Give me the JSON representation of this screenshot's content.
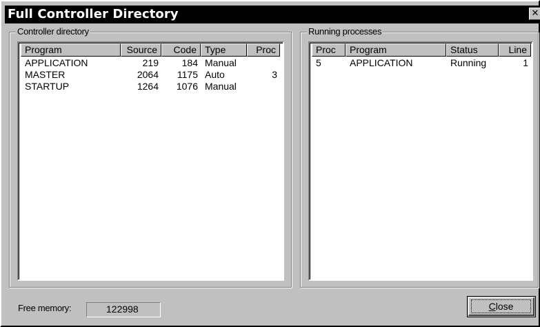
{
  "window": {
    "title": "Full Controller Directory",
    "close_glyph": "✕"
  },
  "controller_directory": {
    "label": "Controller directory",
    "columns": [
      "Program",
      "Source",
      "Code",
      "Type",
      "Proc"
    ],
    "rows": [
      [
        "APPLICATION",
        "219",
        "184",
        "Manual",
        ""
      ],
      [
        "MASTER",
        "2064",
        "1175",
        "Auto",
        "3"
      ],
      [
        "STARTUP",
        "1264",
        "1076",
        "Manual",
        ""
      ]
    ]
  },
  "running_processes": {
    "label": "Running processes",
    "columns": [
      "Proc",
      "Program",
      "Status",
      "Line"
    ],
    "rows": [
      [
        "5",
        "APPLICATION",
        "Running",
        "1"
      ]
    ]
  },
  "footer": {
    "free_memory_label": "Free memory:",
    "free_memory_value": "122998",
    "close_label_mnemonic": "C",
    "close_label_rest": "lose"
  },
  "colors": {
    "face": "#c0c0c0",
    "titlebar": "#000000"
  }
}
